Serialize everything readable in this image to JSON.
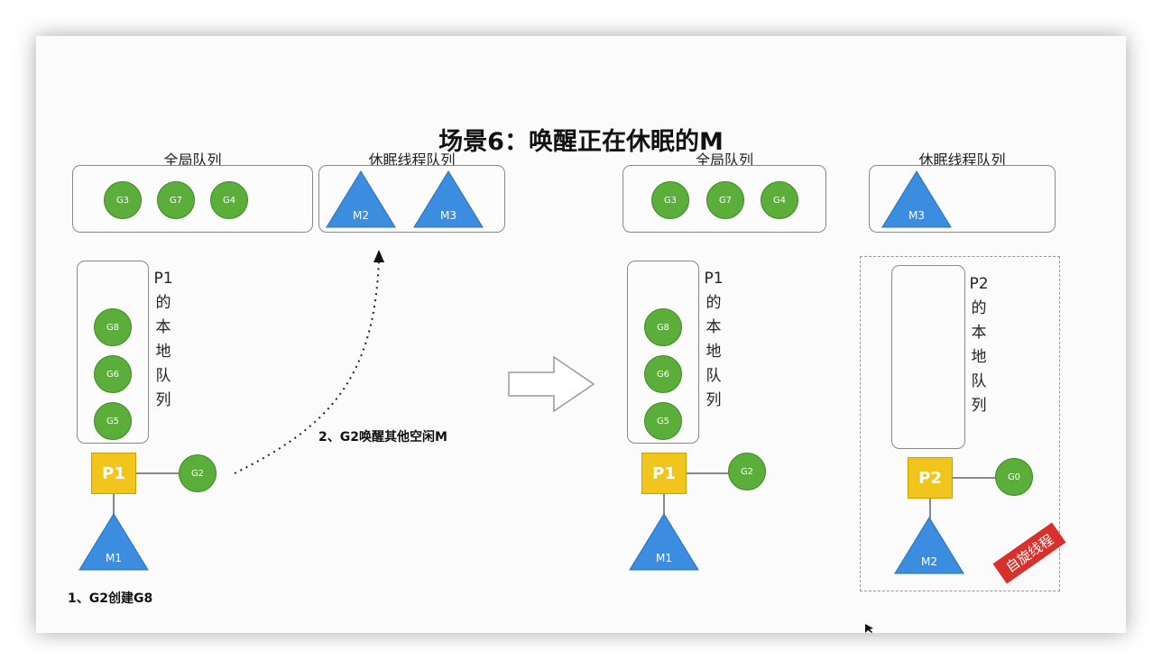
{
  "title": "场景6：唤醒正在休眠的M",
  "left": {
    "global_queue_label": "全局队列",
    "global_queue": [
      "G3",
      "G7",
      "G4"
    ],
    "sleep_queue_label": "休眠线程队列",
    "sleep_queue": [
      "M2",
      "M3"
    ],
    "local_queue_label": [
      "P1",
      "的",
      "本",
      "地",
      "队",
      "列"
    ],
    "local_queue": [
      "G8",
      "G6",
      "G5"
    ],
    "p": "P1",
    "running_g": "G2",
    "m": "M1",
    "note1": "1、G2创建G8",
    "note2": "2、G2唤醒其他空闲M"
  },
  "right": {
    "global_queue_label": "全局队列",
    "global_queue": [
      "G3",
      "G7",
      "G4"
    ],
    "sleep_queue_label": "休眠线程队列",
    "sleep_queue": [
      "M3"
    ],
    "local_queue_label": [
      "P1",
      "的",
      "本",
      "地",
      "队",
      "列"
    ],
    "local_queue": [
      "G8",
      "G6",
      "G5"
    ],
    "p": "P1",
    "running_g": "G2",
    "m": "M1",
    "p2_label": [
      "P2",
      "的",
      "本",
      "地",
      "队",
      "列"
    ],
    "p2": "P2",
    "p2_g": "G0",
    "p2_m": "M2",
    "spin_badge": "自旋线程"
  },
  "colors": {
    "goroutine": "#5cae3a",
    "processor": "#f2c51c",
    "machine": "#3b8de0",
    "badge": "#d9302c"
  }
}
